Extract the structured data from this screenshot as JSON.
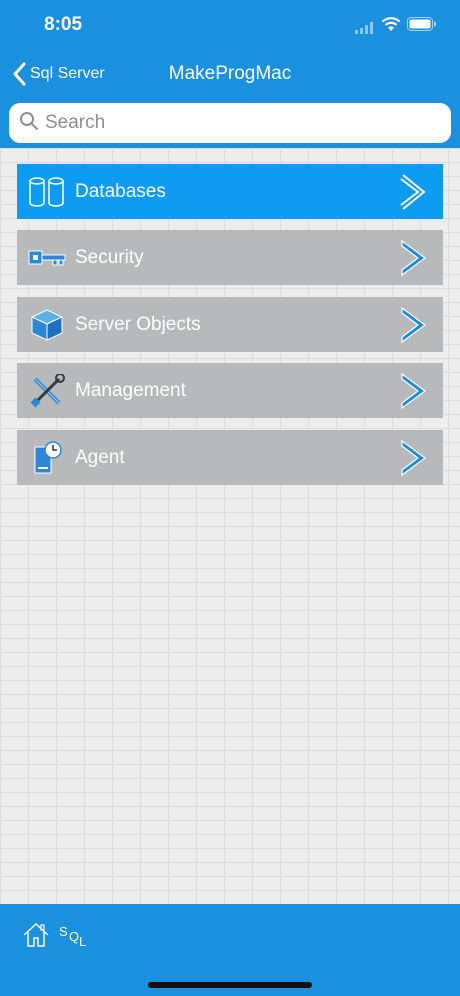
{
  "status": {
    "time": "8:05"
  },
  "nav": {
    "back_label": "Sql Server",
    "title": "MakeProgMac"
  },
  "search": {
    "placeholder": "Search"
  },
  "menu": [
    {
      "label": "Databases",
      "icon": "database-icon",
      "active": true
    },
    {
      "label": "Security",
      "icon": "key-icon",
      "active": false
    },
    {
      "label": "Server Objects",
      "icon": "cube-icon",
      "active": false
    },
    {
      "label": "Management",
      "icon": "tools-icon",
      "active": false
    },
    {
      "label": "Agent",
      "icon": "agent-icon",
      "active": false
    }
  ],
  "toolbar": {
    "sql_label": "SQL"
  },
  "colors": {
    "accent": "#1a90de",
    "active_item": "#0e9cf3",
    "inactive_item": "#b8b9bb",
    "chevron": "#1a8ce0"
  }
}
